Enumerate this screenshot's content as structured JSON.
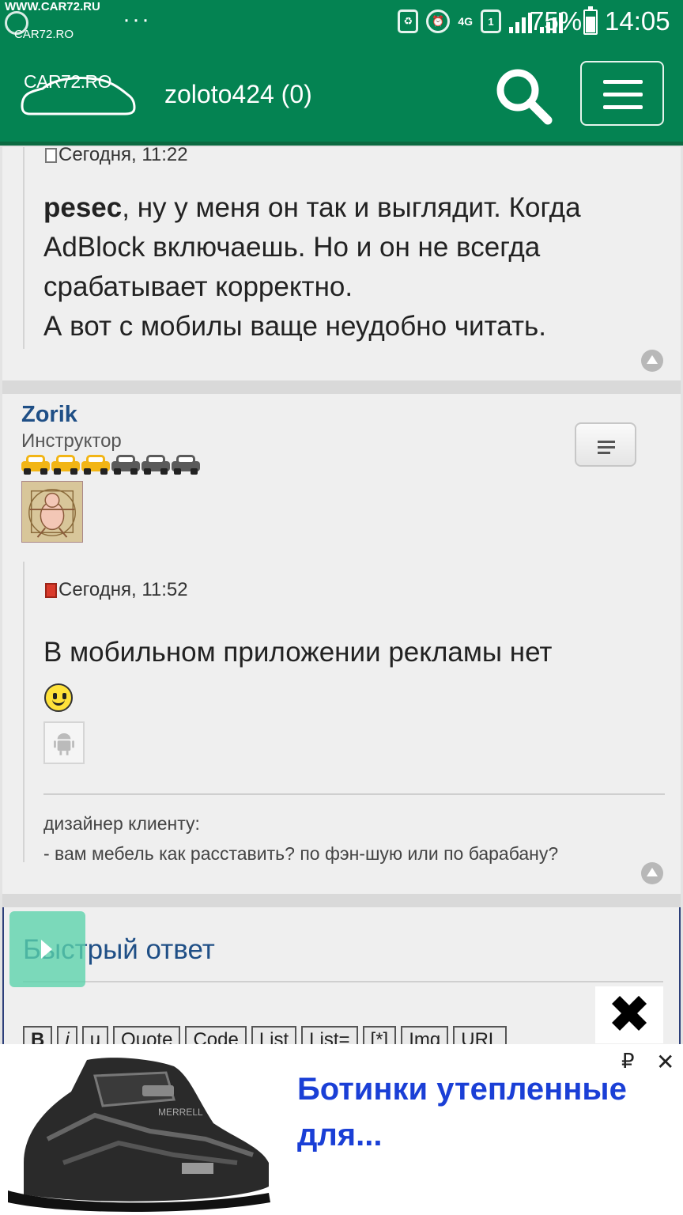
{
  "status_bar": {
    "watermark_top": "WWW.CAR72.RU",
    "watermark_bottom": "CAR72.RO",
    "more_dots": "···",
    "network": "4G",
    "sim": "1",
    "battery": "75%",
    "time": "14:05"
  },
  "header": {
    "logo_text": "CAR72.RO",
    "username": "zoloto424 (0)"
  },
  "post1": {
    "date": "Сегодня, 11:22",
    "author_ref": "pesec",
    "text_after_ref": ", ну у меня он так и выглядит. Когда AdBlock включаешь. Но и он не всегда срабатывает корректно.",
    "text_line2": "А вот с мобилы ваще неудобно читать."
  },
  "post2": {
    "author": "Zorik",
    "role": "Инструктор",
    "rating_filled": 3,
    "rating_total": 6,
    "date": "Сегодня, 11:52",
    "text": "В мобильном приложении рекламы нет",
    "signature_line1": "дизайнер клиенту:",
    "signature_line2": "- вам мебель как расставить? по фэн-шую или по барабану?"
  },
  "quick_reply": {
    "title": "Быстрый ответ",
    "toolbar": [
      "B",
      "i",
      "u",
      "Quote",
      "Code",
      "List",
      "List=",
      "[*]",
      "Img",
      "URL"
    ]
  },
  "ad": {
    "title": "Ботинки утепленные для...",
    "currency_icon": "₽",
    "close_icon": "✕"
  },
  "colors": {
    "header_green": "#048352",
    "link_blue": "#1f4f86",
    "ad_blue": "#1a3fd6"
  }
}
